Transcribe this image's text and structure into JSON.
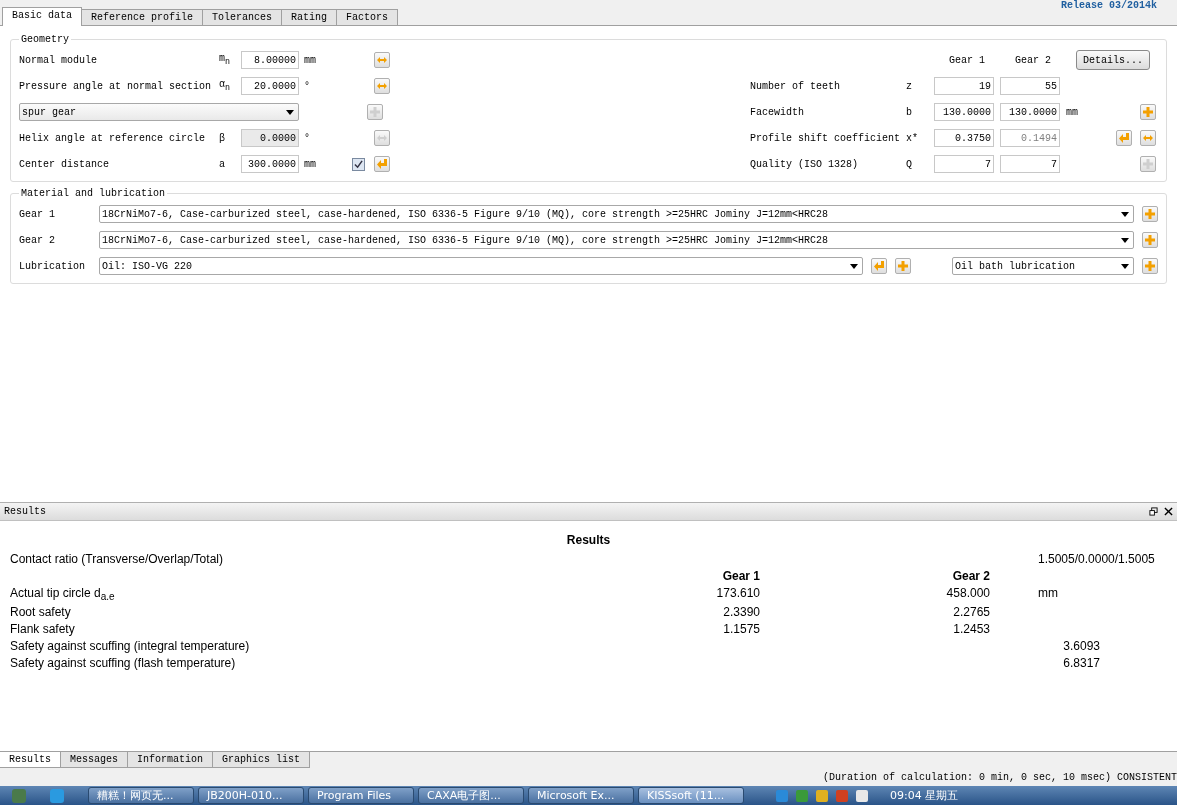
{
  "release": "Release 03/2014k",
  "tabs": [
    {
      "label": "Basic data",
      "selected": true
    },
    {
      "label": "Reference profile",
      "selected": false
    },
    {
      "label": "Tolerances",
      "selected": false
    },
    {
      "label": "Rating",
      "selected": false
    },
    {
      "label": "Factors",
      "selected": false
    }
  ],
  "geometry": {
    "title": "Geometry",
    "left_rows": [
      {
        "kind": "field",
        "label": "Normal module",
        "symbol": "m$_{n}$",
        "value": "8.00000",
        "unit": "mm",
        "disabled": false,
        "buttons": [
          {
            "kind": "swap",
            "disabled": false
          }
        ]
      },
      {
        "kind": "field",
        "label": "Pressure angle at normal section",
        "symbol": "α$_{n}$",
        "value": "20.0000",
        "unit": "°",
        "disabled": false,
        "buttons": [
          {
            "kind": "swap",
            "disabled": false
          }
        ]
      },
      {
        "kind": "dropdown",
        "value": "spur gear",
        "buttons": [
          {
            "kind": "add",
            "disabled": true
          }
        ]
      },
      {
        "kind": "field",
        "label": "Helix angle at reference circle",
        "symbol": "β",
        "value": "0.0000",
        "unit": "°",
        "disabled": true,
        "buttons": [
          {
            "kind": "swap",
            "disabled": true
          }
        ]
      },
      {
        "kind": "field",
        "label": "Center distance",
        "symbol": "a",
        "value": "300.0000",
        "unit": "mm",
        "disabled": false,
        "checked": true,
        "buttons": [
          {
            "kind": "back",
            "disabled": false
          }
        ]
      }
    ],
    "columns": [
      "Gear 1",
      "Gear 2"
    ],
    "details_button": "Details...",
    "right_rows": [
      {
        "label": "Number of teeth",
        "symbol": "z",
        "values": [
          {
            "value": "19",
            "disabled": false
          },
          {
            "value": "55",
            "disabled": false
          }
        ],
        "buttons": []
      },
      {
        "label": "Facewidth",
        "symbol": "b",
        "values": [
          {
            "value": "130.0000",
            "disabled": false
          },
          {
            "value": "130.0000",
            "disabled": false
          }
        ],
        "unit": "mm",
        "buttons": [
          {
            "kind": "add",
            "disabled": false
          }
        ]
      },
      {
        "label": "Profile shift coefficient",
        "symbol": "x*",
        "values": [
          {
            "value": "0.3750",
            "disabled": false
          },
          {
            "value": "0.1494",
            "disabled": true
          }
        ],
        "buttons": [
          {
            "kind": "back",
            "disabled": false
          },
          {
            "kind": "swap",
            "disabled": false
          }
        ]
      },
      {
        "label": "Quality (ISO 1328)",
        "symbol": "Q",
        "values": [
          {
            "value": "7",
            "disabled": false
          },
          {
            "value": "7",
            "disabled": false
          }
        ],
        "buttons": [
          {
            "kind": "add",
            "disabled": true
          }
        ]
      }
    ]
  },
  "material": {
    "title": "Material and lubrication",
    "rows": [
      {
        "label": "Gear 1",
        "value": "18CrNiMo7-6, Case-carburized steel, case-hardened, ISO 6336-5 Figure 9/10 (MQ), core strength >=25HRC Jominy J=12mm<HRC28",
        "buttons": [
          {
            "kind": "add",
            "disabled": false
          }
        ]
      },
      {
        "label": "Gear 2",
        "value": "18CrNiMo7-6, Case-carburized steel, case-hardened, ISO 6336-5 Figure 9/10 (MQ), core strength >=25HRC Jominy J=12mm<HRC28",
        "buttons": [
          {
            "kind": "add",
            "disabled": false
          }
        ]
      },
      {
        "label": "Lubrication",
        "value": "Oil: ISO-VG 220",
        "buttons": [
          {
            "kind": "back",
            "disabled": false
          },
          {
            "kind": "add",
            "disabled": false
          }
        ],
        "second_value": "Oil bath lubrication",
        "second_buttons": [
          {
            "kind": "add",
            "disabled": false
          }
        ]
      }
    ]
  },
  "results_panel": {
    "title": "Results",
    "heading": "Results",
    "columns": [
      "Gear 1",
      "Gear 2"
    ],
    "rows": [
      {
        "label": "Contact ratio (Transverse/Overlap/Total)",
        "value": "1.5005/0.0000/1.5005"
      },
      {
        "label": "Actual tip circle d$_{a.e}$",
        "gear_1": "173.610",
        "gear_2": "458.000",
        "unit": "mm"
      },
      {
        "label": "Root safety",
        "gear_1": "2.3390",
        "gear_2": "2.2765"
      },
      {
        "label": "Flank safety",
        "gear_1": "1.1575",
        "gear_2": "1.2453"
      },
      {
        "label": "Safety against scuffing (integral temperature)",
        "value": "3.6093"
      },
      {
        "label": "Safety against scuffing (flash temperature)",
        "value": "6.8317"
      }
    ]
  },
  "bottom_tabs": [
    {
      "label": "Results",
      "selected": true
    },
    {
      "label": "Messages",
      "selected": false
    },
    {
      "label": "Information",
      "selected": false
    },
    {
      "label": "Graphics list",
      "selected": false
    }
  ],
  "status_bar": "(Duration of calculation: 0 min, 0 sec, 10 msec) CONSISTENT",
  "taskbar": {
    "buttons": [
      {
        "label": "糟糕！网页无...",
        "active": false
      },
      {
        "label": "JB200H-010...",
        "active": false
      },
      {
        "label": "Program Files",
        "active": false
      },
      {
        "label": "CAXA电子图...",
        "active": false
      },
      {
        "label": "Microsoft Ex...",
        "active": false
      },
      {
        "label": "KISSsoft (11...",
        "active": true
      }
    ],
    "clock": "09:04 星期五"
  }
}
